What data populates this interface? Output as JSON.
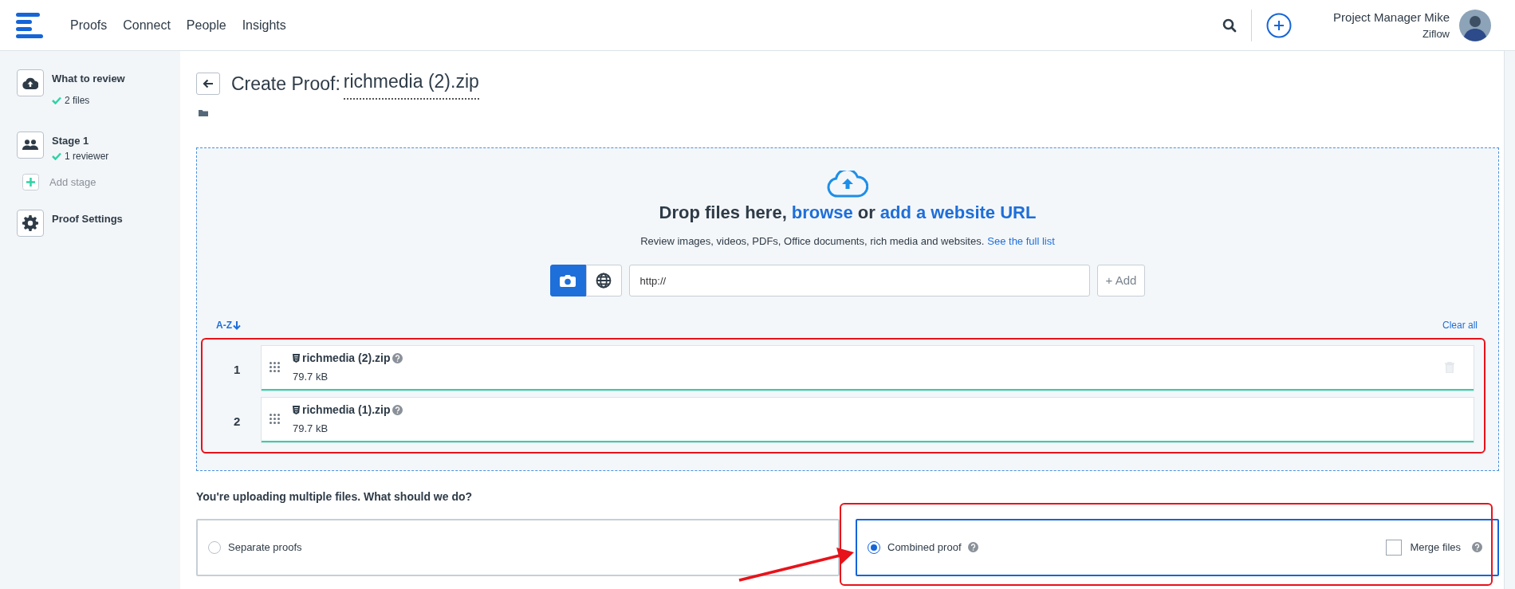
{
  "nav": {
    "links": [
      {
        "label": "Proofs"
      },
      {
        "label": "Connect"
      },
      {
        "label": "People"
      },
      {
        "label": "Insights"
      }
    ]
  },
  "user": {
    "name": "Project Manager Mike",
    "org": "Ziflow"
  },
  "sidebar": {
    "steps": [
      {
        "kind": "upload",
        "title": "What to review",
        "status": "2 files"
      },
      {
        "kind": "stage",
        "title": "Stage 1",
        "status": "1 reviewer"
      },
      {
        "kind": "add",
        "title": "Add stage"
      },
      {
        "kind": "settings",
        "title": "Proof Settings"
      }
    ]
  },
  "header": {
    "title_prefix": "Create Proof:",
    "title_name": "richmedia (2).zip"
  },
  "dropzone": {
    "heading": "Drop files here,",
    "browse_link": "browse",
    "or": "or",
    "url_link": "add a website URL",
    "description": "Review images, videos, PDFs, Office documents, rich media and websites.",
    "list_link": "See the full list",
    "modes": [
      {
        "kind": "upload",
        "selected": true
      },
      {
        "kind": "website",
        "selected": false
      }
    ],
    "url_field": {
      "value": "http://"
    },
    "add_button": "+ Add"
  },
  "files": {
    "sort": "A-Z",
    "clear": "Clear all",
    "items": [
      {
        "index": "1",
        "name": "richmedia (2).zip",
        "size": "79.7 kB",
        "level": 1,
        "hovered": true
      },
      {
        "index": "2",
        "name": "richmedia (1).zip",
        "size": "79.7 kB",
        "level": 1,
        "hovered": false
      }
    ]
  },
  "choice": {
    "question": "You're uploading multiple files. What should we do?",
    "options": [
      {
        "label": "Separate proofs",
        "selected": false,
        "help": false
      },
      {
        "label": "Combined proof",
        "selected": true,
        "help": true,
        "merge": {
          "label": "Merge files",
          "checked": false
        }
      }
    ]
  }
}
